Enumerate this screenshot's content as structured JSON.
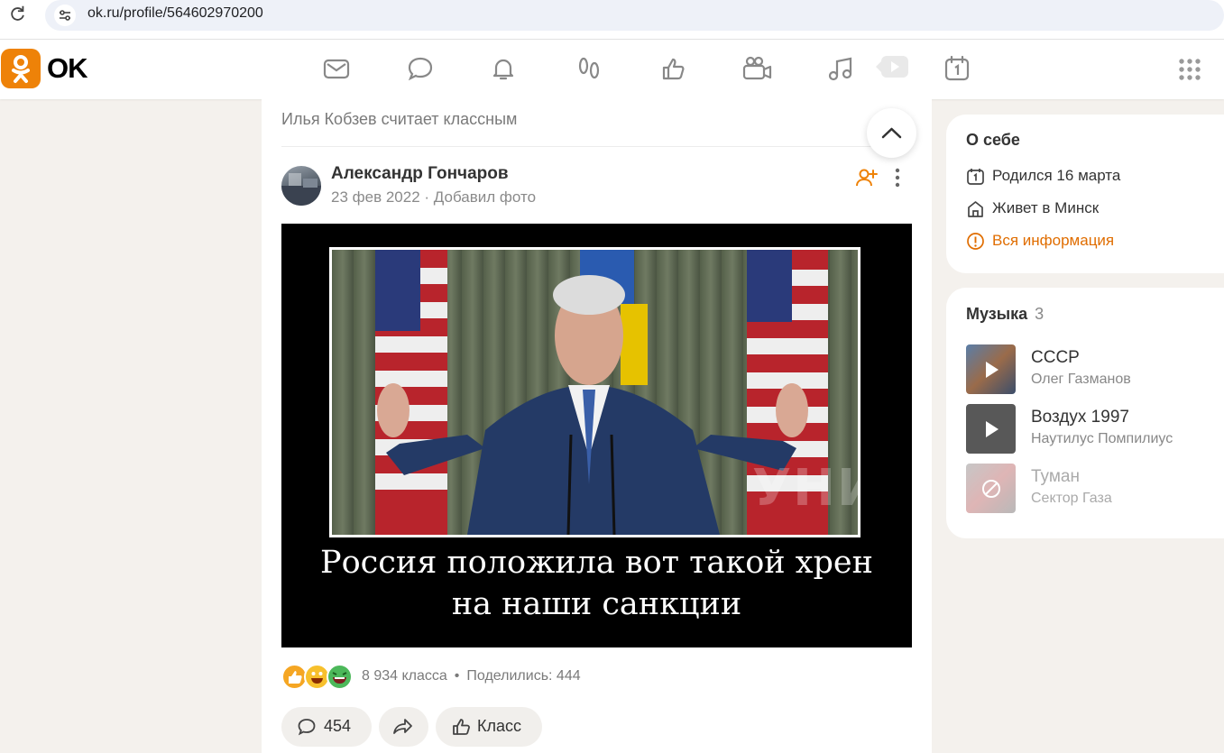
{
  "browser": {
    "url": "ok.ru/profile/564602970200"
  },
  "header": {
    "logo_text": "OK",
    "nav_icons": [
      "mail-icon",
      "chat-icon",
      "bell-icon",
      "guests-footprints-icon",
      "like-icon",
      "video-camera-icon",
      "music-note-icon",
      "play-video-icon",
      "calendar-icon"
    ],
    "apps_icon": "grid-icon"
  },
  "post": {
    "liked_by": "Илья Кобзев считает классным",
    "author": "Александр Гончаров",
    "date": "23 фев 2022",
    "action": "Добавил фото",
    "image": {
      "caption_line1": "Россия положила вот такой хрен",
      "caption_line2": "на наши санкции",
      "watermark": "УНИАН"
    },
    "classes": "8 934 класса",
    "shares": "Поделились: 444",
    "comments_count": "454",
    "class_label": "Класс"
  },
  "sidebar": {
    "about": {
      "title": "О себе",
      "birthday": "Родился 16 марта",
      "lives": "Живет в Минск",
      "all_info": "Вся информация"
    },
    "music": {
      "title": "Музыка",
      "count": "3",
      "tracks": [
        {
          "title": "СССР",
          "artist": "Олег Газманов"
        },
        {
          "title": "Воздух 1997",
          "artist": "Наутилус Помпилиус"
        },
        {
          "title": "Туман",
          "artist": "Сектор Газа"
        }
      ]
    }
  },
  "colors": {
    "accent": "#ee8208",
    "link": "#e06d00",
    "background": "#f4f1ed"
  }
}
